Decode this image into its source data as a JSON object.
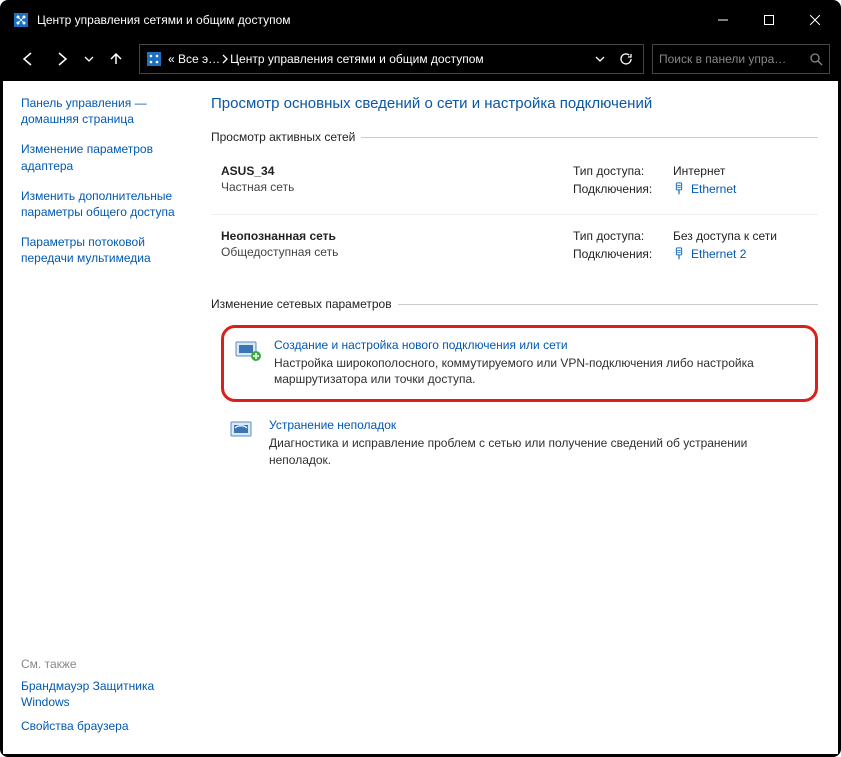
{
  "titlebar": {
    "title": "Центр управления сетями и общим доступом"
  },
  "nav": {
    "back_aria": "Назад",
    "fwd_aria": "Вперёд",
    "breadcrumb_prefix": "« Все э…",
    "breadcrumb_current": "Центр управления сетями и общим доступом",
    "search_placeholder": "Поиск в панели упра…"
  },
  "sidebar": {
    "links": [
      "Панель управления — домашняя страница",
      "Изменение параметров адаптера",
      "Изменить дополнительные параметры общего доступа",
      "Параметры потоковой передачи мультимедиа"
    ],
    "see_also_header": "См. также",
    "see_also": [
      "Брандмауэр Защитника Windows",
      "Свойства браузера"
    ]
  },
  "main": {
    "heading": "Просмотр основных сведений о сети и настройка подключений",
    "active_group": "Просмотр активных сетей",
    "change_group": "Изменение сетевых параметров",
    "networks": [
      {
        "name": "ASUS_34",
        "kind": "Частная сеть",
        "access_label": "Тип доступа:",
        "access_value": "Интернет",
        "conn_label": "Подключения:",
        "conn_link": "Ethernet",
        "access_is_link": false
      },
      {
        "name": "Неопознанная сеть",
        "kind": "Общедоступная сеть",
        "access_label": "Тип доступа:",
        "access_value": "Без доступа к сети",
        "conn_label": "Подключения:",
        "conn_link": "Ethernet 2",
        "access_is_link": false
      }
    ],
    "tasks": [
      {
        "link": "Создание и настройка нового подключения или сети",
        "desc": "Настройка широкополосного, коммутируемого или VPN-подключения либо настройка маршрутизатора или точки доступа.",
        "highlight": true
      },
      {
        "link": "Устранение неполадок",
        "desc": "Диагностика и исправление проблем с сетью или получение сведений об устранении неполадок.",
        "highlight": false
      }
    ]
  }
}
